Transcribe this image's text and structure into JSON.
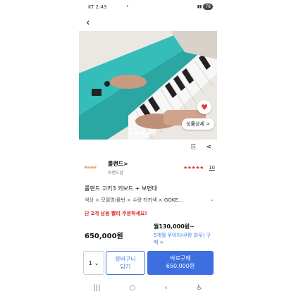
{
  "status_bar": {
    "carrier_time": "KT 2:43",
    "battery": "78"
  },
  "product": {
    "brand_logo": "Roland",
    "brand_name": "롤랜드>",
    "brand_shop": "브랜드샵",
    "rating_count": "10",
    "title": "롤랜드 고키3 키보드 + 보면대",
    "options_label": "색상 × 모델명/품번 × 수량",
    "options_value": "터키색 × GOKE...",
    "urgent_notice": "단 2개 남음 빨리 주문하세요!",
    "price": "650,000원",
    "monthly_price": "월130,000원~",
    "installment_note": "5개월 무이자(쿠팡 와우) 구매 >",
    "detail_button": "상품상세 >"
  },
  "purchase": {
    "quantity": "1",
    "cart_label_1": "장바구니",
    "cart_label_2": "담기",
    "buy_label": "바로구매",
    "buy_price": "650,000원"
  },
  "colors": {
    "accent_blue": "#3d6fe0",
    "urgent_red": "#e02525",
    "keyboard_teal": "#2fb7b4"
  }
}
